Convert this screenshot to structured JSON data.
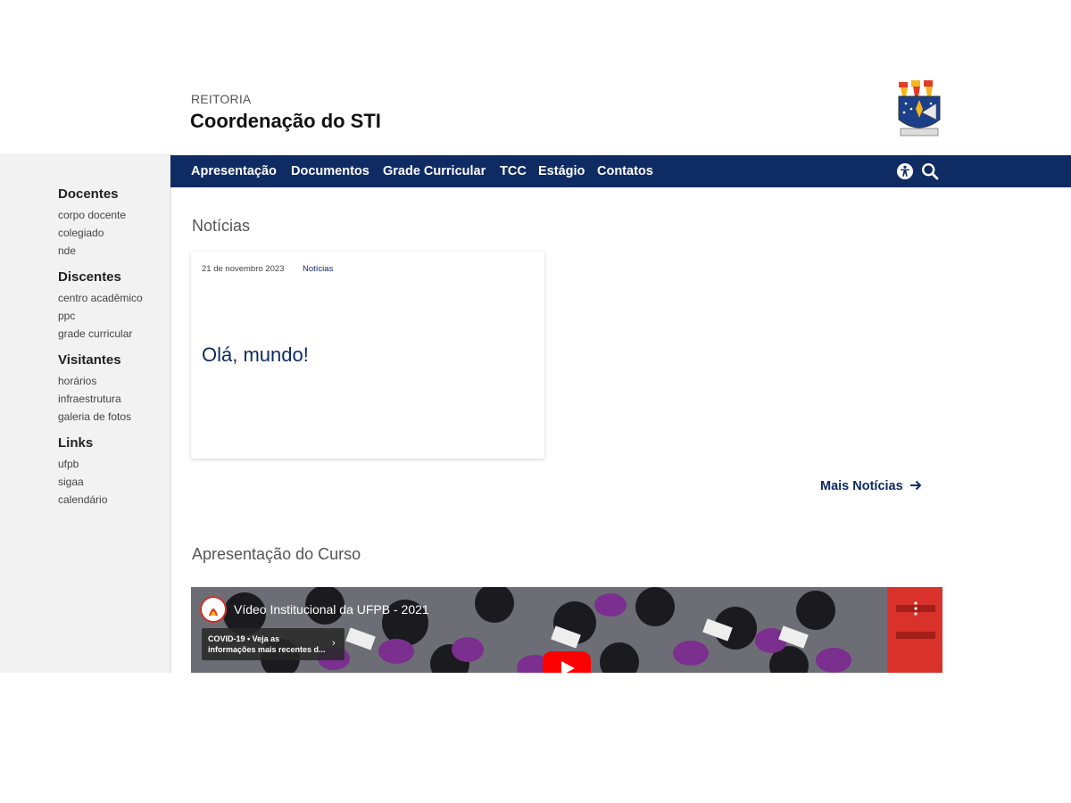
{
  "header": {
    "org": "REITORIA",
    "title": "Coordenação do STI",
    "crest_icon": "ufpb-crest-icon"
  },
  "nav": {
    "items": [
      {
        "label": "Apresentação"
      },
      {
        "label": "Documentos"
      },
      {
        "label": "Grade Curricular"
      },
      {
        "label": "TCC"
      },
      {
        "label": "Estágio"
      },
      {
        "label": "Contatos"
      }
    ],
    "accessibility_icon": "accessibility-icon",
    "search_icon": "search-icon",
    "color": "#0f2b64"
  },
  "sidebar": {
    "groups": [
      {
        "heading": "Docentes",
        "links": [
          "corpo docente",
          "colegiado",
          "nde"
        ]
      },
      {
        "heading": "Discentes",
        "links": [
          "centro acadêmico",
          "ppc",
          "grade curricular"
        ]
      },
      {
        "heading": "Visitantes",
        "links": [
          "horários",
          "infraestrutura",
          "galeria de fotos"
        ]
      },
      {
        "heading": "Links",
        "links": [
          "ufpb",
          "sigaa",
          "calendário"
        ]
      }
    ]
  },
  "news": {
    "section_title": "Notícias",
    "card": {
      "date": "21 de novembro 2023",
      "category": "Notícias",
      "title": "Olá, mundo!"
    },
    "more_label": "Mais Notícias",
    "more_icon": "arrow-right-icon"
  },
  "course": {
    "section_title": "Apresentação do Curso",
    "video": {
      "title": "Vídeo Institucional da UFPB - 2021",
      "covid_line1": "COVID-19 • Veja as",
      "covid_line2": "informações mais recentes d...",
      "menu_icon": "more-vertical-icon",
      "play_icon": "play-icon"
    }
  }
}
